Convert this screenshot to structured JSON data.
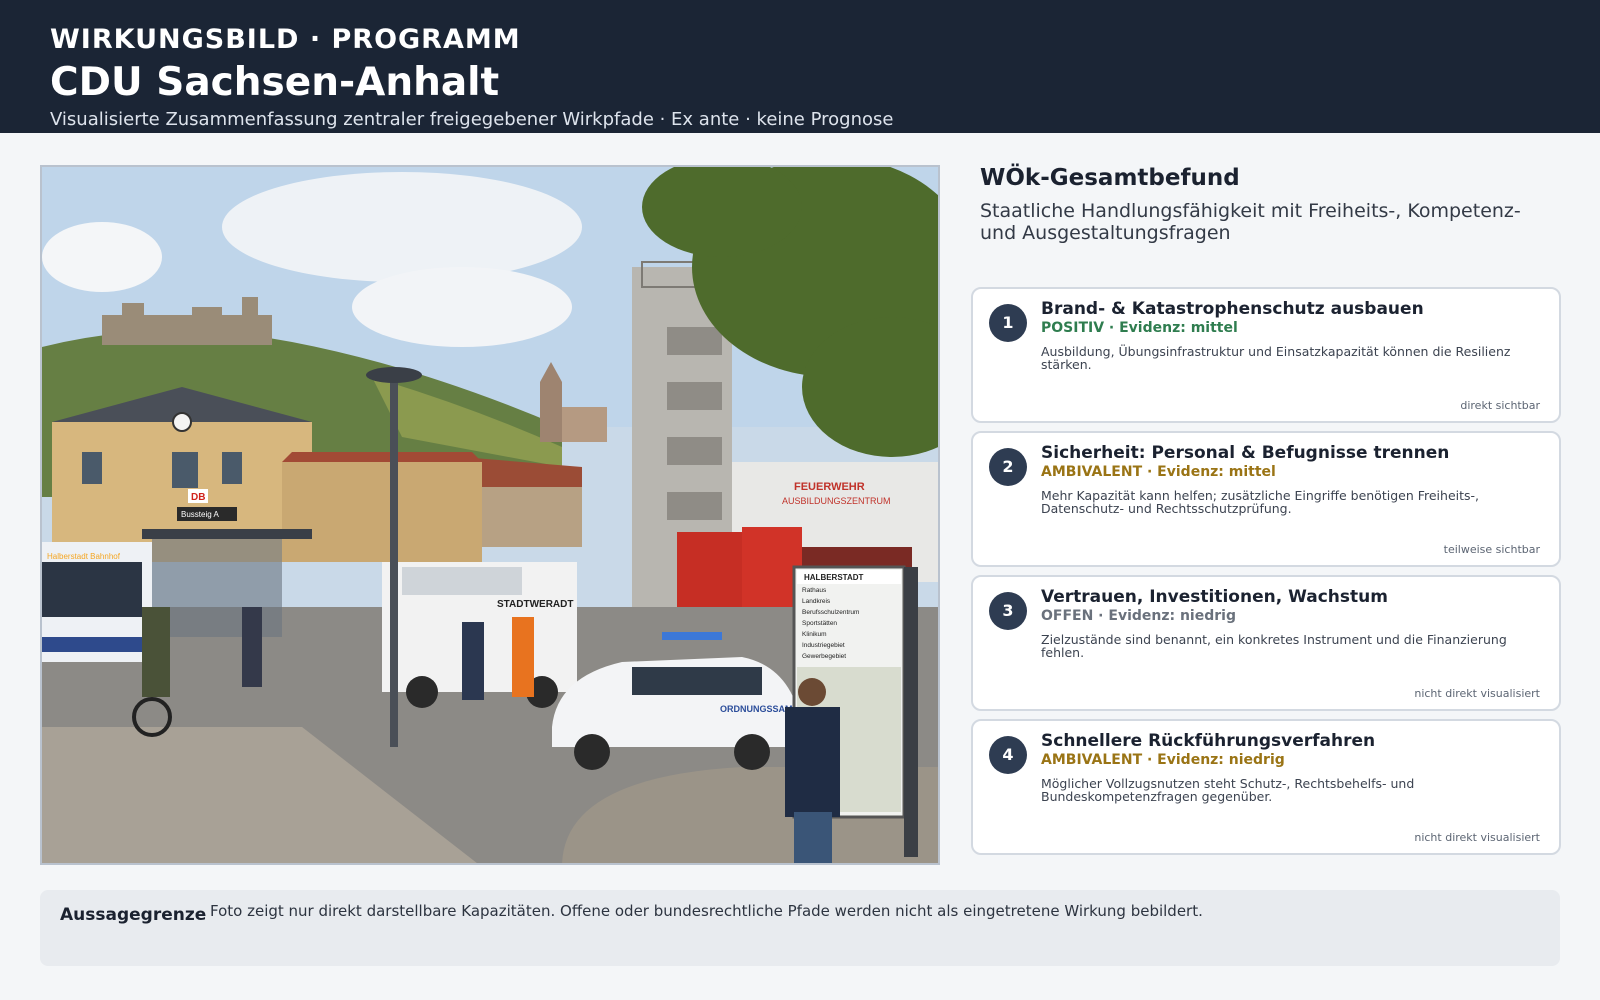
{
  "header": {
    "kicker": "WIRKUNGSBILD · PROGRAMM",
    "title": "CDU Sachsen-Anhalt",
    "subtitle": "Visualisierte Zusammenfassung zentraler freigegebener Wirkpfade · Ex ante · keine Prognose"
  },
  "photo": {
    "signs": {
      "db": "DB",
      "bussteig": "Bussteig A",
      "bus_destination": "Halberstadt Bahnhof",
      "van": "STADTWERADT",
      "fire_station": [
        "FEUERWEHR",
        "AUSBILDUNGSZENTRUM"
      ],
      "police_car": "ORDNUNGSSAMT",
      "guide_title": "HALBERSTADT",
      "guide_items": [
        "Rathaus",
        "Landkreis",
        "Berufsschulzentrum",
        "Sportstätten",
        "Klinikum",
        "Industriegebiet",
        "Gewerbegebiet"
      ]
    }
  },
  "summary": {
    "heading": "WÖk-Gesamtbefund",
    "text": "Staatliche Handlungsfähigkeit mit Freiheits-, Kompetenz- und Ausgestaltungsfragen"
  },
  "colors": {
    "positiv": "#2f7d4f",
    "ambivalent": "#9a7415",
    "offen": "#6a717c"
  },
  "cards": [
    {
      "number": "1",
      "title": "Brand- & Katastrophenschutz ausbauen",
      "status": "POSITIV · Evidenz: mittel",
      "status_color": "#2f7d4f",
      "description": "Ausbildung, Übungsinfrastruktur und Einsatzkapazität können die Resilienz stärken.",
      "visibility": "direkt sichtbar"
    },
    {
      "number": "2",
      "title": "Sicherheit: Personal & Befugnisse trennen",
      "status": "AMBIVALENT · Evidenz: mittel",
      "status_color": "#9a7415",
      "description": "Mehr Kapazität kann helfen; zusätzliche Eingriffe benötigen Freiheits-, Datenschutz- und Rechtsschutzprüfung.",
      "visibility": "teilweise sichtbar"
    },
    {
      "number": "3",
      "title": "Vertrauen, Investitionen, Wachstum",
      "status": "OFFEN · Evidenz: niedrig",
      "status_color": "#6a717c",
      "description": "Zielzustände sind benannt, ein konkretes Instrument und die Finanzierung fehlen.",
      "visibility": "nicht direkt visualisiert"
    },
    {
      "number": "4",
      "title": "Schnellere Rückführungsverfahren",
      "status": "AMBIVALENT · Evidenz: niedrig",
      "status_color": "#9a7415",
      "description": "Möglicher Vollzugsnutzen steht Schutz-, Rechtsbehelfs- und Bundeskompetenzfragen gegenüber.",
      "visibility": "nicht direkt visualisiert"
    }
  ],
  "footer": {
    "label": "Aussagegrenze",
    "text": "Foto zeigt nur direkt darstellbare Kapazitäten. Offene oder bundesrechtliche Pfade werden nicht als eingetretene Wirkung bebildert."
  }
}
